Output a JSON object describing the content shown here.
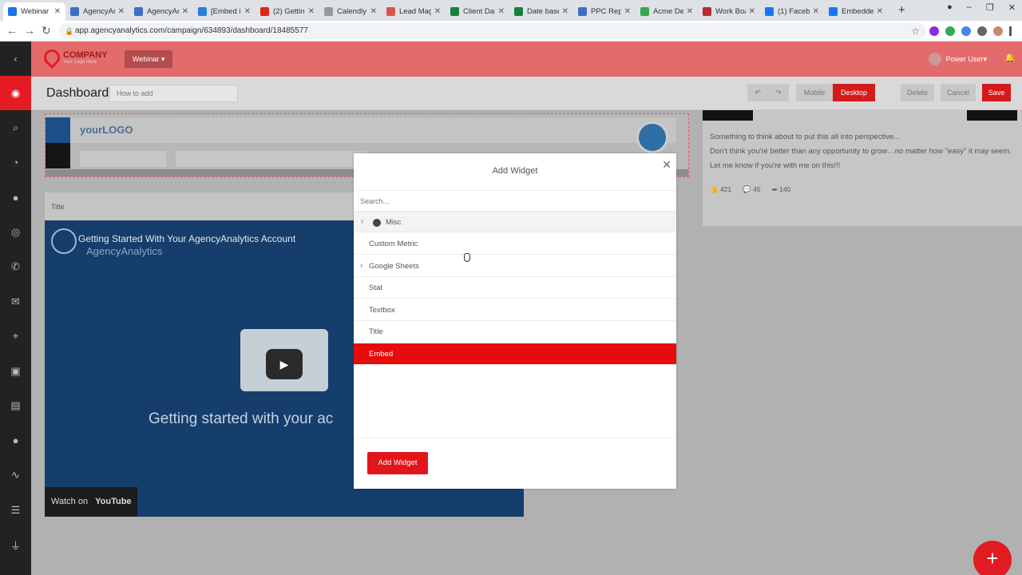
{
  "browser": {
    "tabs": [
      {
        "label": "Webinar",
        "active": true,
        "color": "#1a73e8"
      },
      {
        "label": "AgencyAn",
        "color": "#3b6fc1"
      },
      {
        "label": "AgencyAn",
        "color": "#3b6fc1"
      },
      {
        "label": "[Embed in",
        "color": "#2a7de1"
      },
      {
        "label": "(2) Getting",
        "color": "#e62117"
      },
      {
        "label": "Calendly",
        "color": "#999999"
      },
      {
        "label": "Lead Mag",
        "color": "#d9534f"
      },
      {
        "label": "Client Das",
        "color": "#188038"
      },
      {
        "label": "Date base",
        "color": "#188038"
      },
      {
        "label": "PPC Repo",
        "color": "#3b6fc1"
      },
      {
        "label": "Acme Den",
        "color": "#34a853"
      },
      {
        "label": "Work Boa",
        "color": "#b52e2e"
      },
      {
        "label": "(1) Facebo",
        "color": "#1877f2"
      },
      {
        "label": "Embedde",
        "color": "#1877f2"
      }
    ],
    "url": "app.agencyanalytics.com/campaign/634893/dashboard/18485577"
  },
  "header": {
    "logo_title": "COMPANY",
    "logo_sub": "Your Logo Here",
    "campaign": "Webinar",
    "user": "Power User"
  },
  "sidebar": {
    "items": [
      "dashboard-icon",
      "search-icon",
      "pie-chart-icon",
      "chat-icon",
      "target-icon",
      "phone-icon",
      "mail-icon",
      "location-icon",
      "cart-icon",
      "file-icon",
      "user-icon",
      "activity-icon",
      "list-icon",
      "plug-icon"
    ]
  },
  "toolbar": {
    "title": "Dashboard",
    "note_placeholder": "How to add",
    "undo": "↶",
    "redo": "↷",
    "mobile": "Mobile",
    "desktop": "Desktop",
    "delete": "Delete",
    "cancel": "Cancel",
    "save": "Save"
  },
  "canvas": {
    "logo_text": "yourLOGO",
    "title_widget": "Title",
    "video": {
      "title": "Getting Started With Your AgencyAnalytics Account",
      "channel": "AgencyAnalytics",
      "overlay": "Getting started with your ac",
      "watch_on": "Watch on",
      "youtube": "YouTube"
    },
    "post": {
      "lines": [
        "Something to think about to put this all into perspective...",
        "Don't think you're better than any opportunity to grow…no matter how \"easy\" it may seem.",
        "Let me know if you're with me on this!!!"
      ],
      "likes": "421",
      "comments": "45",
      "shares": "140"
    }
  },
  "modal": {
    "title": "Add Widget",
    "search_placeholder": "Search...",
    "category": "Misc",
    "items": [
      {
        "label": "Custom Metric",
        "expandable": false,
        "selected": false
      },
      {
        "label": "Google Sheets",
        "expandable": true,
        "selected": false
      },
      {
        "label": "Stat",
        "expandable": false,
        "selected": false
      },
      {
        "label": "Textbox",
        "expandable": false,
        "selected": false
      },
      {
        "label": "Title",
        "expandable": false,
        "selected": false
      },
      {
        "label": "Embed",
        "expandable": false,
        "selected": true
      }
    ],
    "add_button": "Add Widget"
  },
  "colors": {
    "accent": "#e51b24",
    "header": "#e36b6b",
    "sidebar": "#222222"
  }
}
